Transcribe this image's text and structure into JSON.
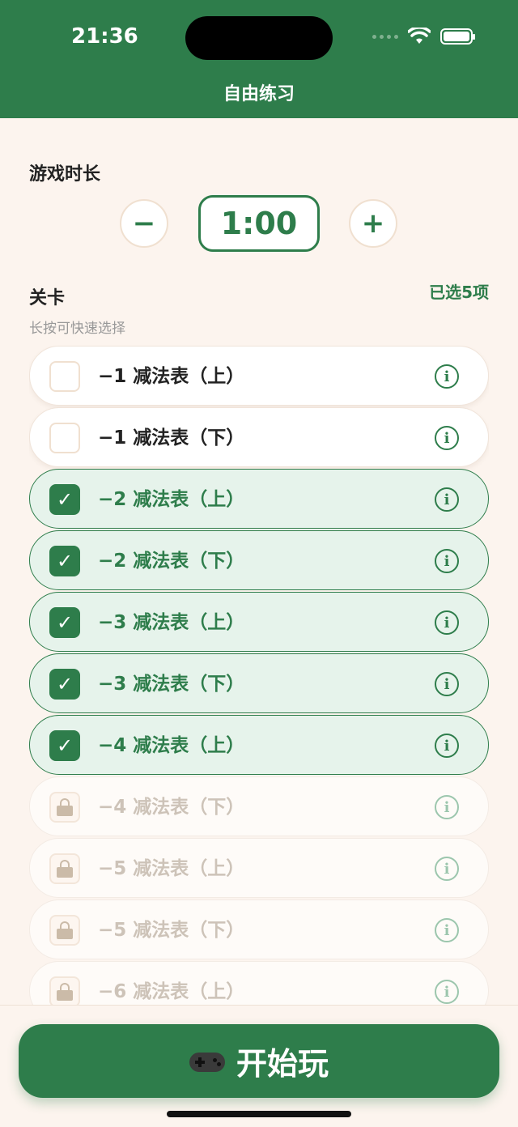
{
  "status_bar": {
    "time": "21:36"
  },
  "nav": {
    "title": "自由练习"
  },
  "duration": {
    "title": "游戏时长",
    "value": "1:00",
    "minus": "−",
    "plus": "+"
  },
  "levels": {
    "title": "关卡",
    "selected_count": "已选5项",
    "hint": "长按可快速选择",
    "items": [
      {
        "label": "−1 减法表（上）",
        "state": "unchecked"
      },
      {
        "label": "−1 减法表（下）",
        "state": "unchecked"
      },
      {
        "label": "−2 减法表（上）",
        "state": "checked"
      },
      {
        "label": "−2 减法表（下）",
        "state": "checked"
      },
      {
        "label": "−3 减法表（上）",
        "state": "checked"
      },
      {
        "label": "−3 减法表（下）",
        "state": "checked"
      },
      {
        "label": "−4 减法表（上）",
        "state": "checked"
      },
      {
        "label": "−4 减法表（下）",
        "state": "locked"
      },
      {
        "label": "−5 减法表（上）",
        "state": "locked"
      },
      {
        "label": "−5 减法表（下）",
        "state": "locked"
      },
      {
        "label": "−6 减法表（上）",
        "state": "locked"
      }
    ]
  },
  "play": {
    "label": "开始玩",
    "icon": "game-controller-icon"
  },
  "colors": {
    "primary": "#2e7d4b",
    "background": "#fcf4ee",
    "selected_bg": "#e6f3eb"
  }
}
